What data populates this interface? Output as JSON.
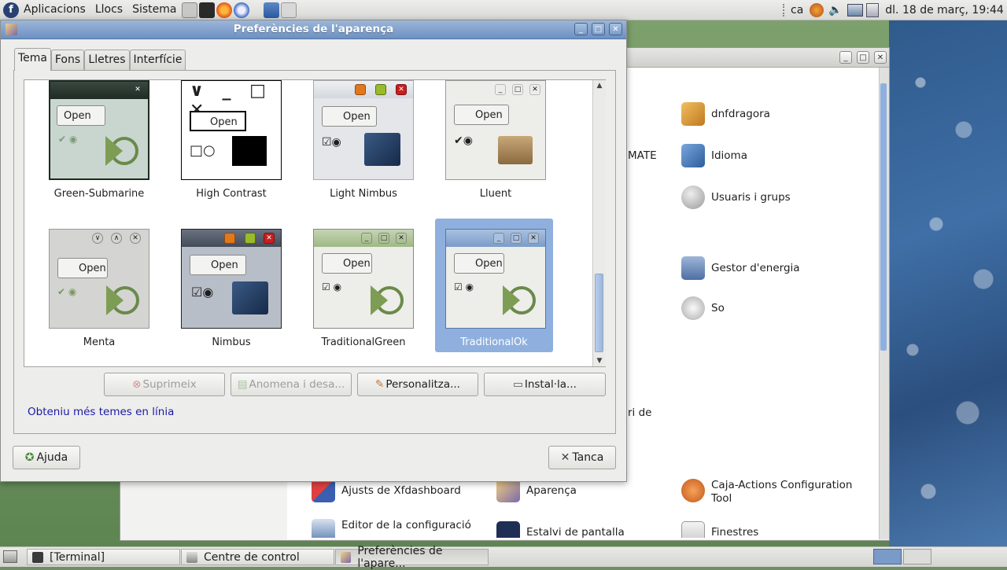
{
  "top_panel": {
    "menus": [
      "Aplicacions",
      "Llocs",
      "Sistema"
    ],
    "keyboard_layout": "ca",
    "clock": "dl. 18 de març, 19:44"
  },
  "bottom_panel": {
    "tasks": [
      "[Terminal]",
      "Centre de control",
      "Preferències de l'apare..."
    ]
  },
  "control_center": {
    "items": [
      {
        "label": "dnfdragora",
        "icon": "package-icon",
        "color": "#e0a040"
      },
      {
        "label": "Idioma",
        "icon": "flag-icon",
        "color": "#4a7fc0"
      },
      {
        "label": "Usuaris i grups",
        "icon": "users-icon",
        "color": "#b8b8b8"
      },
      {
        "label": "Gestor d'energia",
        "icon": "battery-icon",
        "color": "#6a8cc0"
      },
      {
        "label": "So",
        "icon": "speaker-icon",
        "color": "#c8c8c8"
      },
      {
        "label": "Ajusts de Xfdashboard",
        "icon": "xfdashboard-icon",
        "color": "#d04040"
      },
      {
        "label": "Aparença",
        "icon": "appearance-icon",
        "color": "#e0b060"
      },
      {
        "label": "Caja-Actions Configuration Tool",
        "icon": "caja-actions-icon",
        "color": "#e07a30"
      },
      {
        "label": "Editor de la configuració",
        "icon": "editor-icon",
        "color": "#5a7fb0"
      },
      {
        "label": "Estalvi de pantalla",
        "icon": "screensaver-icon",
        "color": "#1f2e55"
      },
      {
        "label": "Finestres",
        "icon": "window-icon",
        "color": "#d8d8d8"
      }
    ],
    "partial_texts": [
      "MATE",
      "ri de"
    ]
  },
  "dialog": {
    "title": "Preferències de l'aparença",
    "tabs": [
      "Tema",
      "Fons",
      "Lletres",
      "Interfície"
    ],
    "active_tab": "Tema",
    "themes": [
      {
        "name": "Green-Submarine",
        "selected": false
      },
      {
        "name": "High Contrast",
        "selected": false
      },
      {
        "name": "Light Nimbus",
        "selected": false
      },
      {
        "name": "Lluent",
        "selected": false
      },
      {
        "name": "Menta",
        "selected": false
      },
      {
        "name": "Nimbus",
        "selected": false
      },
      {
        "name": "TraditionalGreen",
        "selected": false
      },
      {
        "name": "TraditionalOk",
        "selected": true
      }
    ],
    "preview_button_label": "Open",
    "buttons": {
      "delete": "Suprimeix",
      "save_as": "Anomena i desa...",
      "customize": "Personalitza...",
      "install": "Instal·la..."
    },
    "online_link": "Obteniu més temes en línia",
    "help": "Ajuda",
    "close": "Tanca",
    "colors": {
      "titlebar": "#7b9cc8",
      "selection": "#8fb0de",
      "link": "#1a1aa6"
    }
  }
}
